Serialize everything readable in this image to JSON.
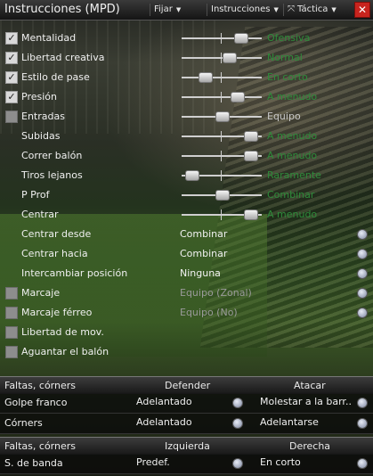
{
  "window": {
    "title": "Instrucciones (MPD)",
    "menus": [
      "Fijar",
      "Instrucciones",
      "Táctica"
    ]
  },
  "sliders": [
    {
      "label": "Mentalidad",
      "checked": true,
      "value_text": "Ofensiva",
      "level": 0.78
    },
    {
      "label": "Libertad creativa",
      "checked": true,
      "value_text": "Normal",
      "level": 0.6
    },
    {
      "label": "Estilo de pase",
      "checked": true,
      "value_text": "En corto",
      "level": 0.25
    },
    {
      "label": "Presión",
      "checked": true,
      "value_text": "A menudo",
      "level": 0.72
    },
    {
      "label": "Entradas",
      "checked": false,
      "value_text": "Equipo",
      "level": 0.5,
      "disabled": true
    },
    {
      "label": "Subidas",
      "checked": null,
      "value_text": "A menudo",
      "level": 0.92
    },
    {
      "label": "Correr balón",
      "checked": null,
      "value_text": "A menudo",
      "level": 0.92
    },
    {
      "label": "Tiros lejanos",
      "checked": null,
      "value_text": "Raramente",
      "level": 0.05
    },
    {
      "label": "P Prof",
      "checked": null,
      "value_text": "Combinar",
      "level": 0.5
    },
    {
      "label": "Centrar",
      "checked": null,
      "value_text": "A menudo",
      "level": 0.92
    }
  ],
  "dropdowns": [
    {
      "label": "Centrar desde",
      "checked": null,
      "value": "Combinar",
      "disabled": false
    },
    {
      "label": "Centrar hacia",
      "checked": null,
      "value": "Combinar",
      "disabled": false
    },
    {
      "label": "Intercambiar posición",
      "checked": null,
      "value": "Ninguna",
      "disabled": false
    },
    {
      "label": "Marcaje",
      "checked": false,
      "value": "Equipo (Zonal)",
      "disabled": true
    },
    {
      "label": "Marcaje férreo",
      "checked": false,
      "value": "Equipo (No)",
      "disabled": true
    },
    {
      "label": "Libertad de mov.",
      "checked": false,
      "value": "",
      "disabled": true
    },
    {
      "label": "Aguantar el balón",
      "checked": false,
      "value": "",
      "disabled": true
    }
  ],
  "set_pieces_1": {
    "header": {
      "label": "Faltas, córners",
      "col1": "Defender",
      "col2": "Atacar"
    },
    "rows": [
      {
        "label": "Golpe franco",
        "col1": "Adelantado",
        "col2": "Molestar a la barr.."
      },
      {
        "label": "Córners",
        "col1": "Adelantado",
        "col2": "Adelantarse"
      }
    ]
  },
  "set_pieces_2": {
    "header": {
      "label": "Faltas, córners",
      "col1": "Izquierda",
      "col2": "Derecha"
    },
    "rows": [
      {
        "label": "S. de banda",
        "col1": "Predef.",
        "col2": "En corto"
      }
    ]
  },
  "colors": {
    "value_green": "#2e8b3a",
    "close_red": "#c8241e"
  }
}
